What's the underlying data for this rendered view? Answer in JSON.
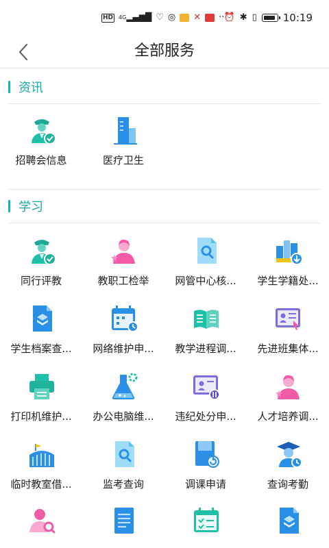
{
  "status_bar": {
    "network": "4G",
    "hd": "HD",
    "more": "···",
    "time": "10:19"
  },
  "nav": {
    "title": "全部服务"
  },
  "sections": [
    {
      "title": "资讯",
      "items": [
        {
          "label": "招聘会信息",
          "icon": "officer-check-icon"
        },
        {
          "label": "医疗卫生",
          "icon": "hospital-building-icon"
        }
      ]
    },
    {
      "title": "学习",
      "items": [
        {
          "label": "同行评教",
          "icon": "officer-check-icon"
        },
        {
          "label": "教职工检举",
          "icon": "person-pink-icon"
        },
        {
          "label": "网管中心核...",
          "icon": "document-search-icon"
        },
        {
          "label": "学生学籍处...",
          "icon": "buildings-download-icon"
        },
        {
          "label": "学生档案查...",
          "icon": "layers-document-icon"
        },
        {
          "label": "网络维护申...",
          "icon": "calendar-clock-icon"
        },
        {
          "label": "教学进程调...",
          "icon": "open-book-icon"
        },
        {
          "label": "先进班集体...",
          "icon": "id-card-cursor-icon"
        },
        {
          "label": "打印机维护...",
          "icon": "printer-icon"
        },
        {
          "label": "办公电脑维...",
          "icon": "flask-gear-icon"
        },
        {
          "label": "违纪处分申...",
          "icon": "id-card-adjust-icon"
        },
        {
          "label": "人才培养调...",
          "icon": "person-pink-icon"
        },
        {
          "label": "临时教室借...",
          "icon": "stadium-icon"
        },
        {
          "label": "监考查询",
          "icon": "document-search-icon"
        },
        {
          "label": "调课申请",
          "icon": "book-refresh-icon"
        },
        {
          "label": "查询考勤",
          "icon": "graduate-clock-icon"
        },
        {
          "label": "",
          "icon": "person-search-icon"
        },
        {
          "label": "",
          "icon": "text-document-icon"
        },
        {
          "label": "",
          "icon": "calendar-check-icon"
        },
        {
          "label": "",
          "icon": "layers-document-icon"
        }
      ]
    }
  ],
  "colors": {
    "accent": "#17aaa6",
    "blue": "#2a8fe6",
    "teal": "#1fc0a8",
    "pink": "#f05aa6",
    "purple": "#7a6ee0"
  }
}
